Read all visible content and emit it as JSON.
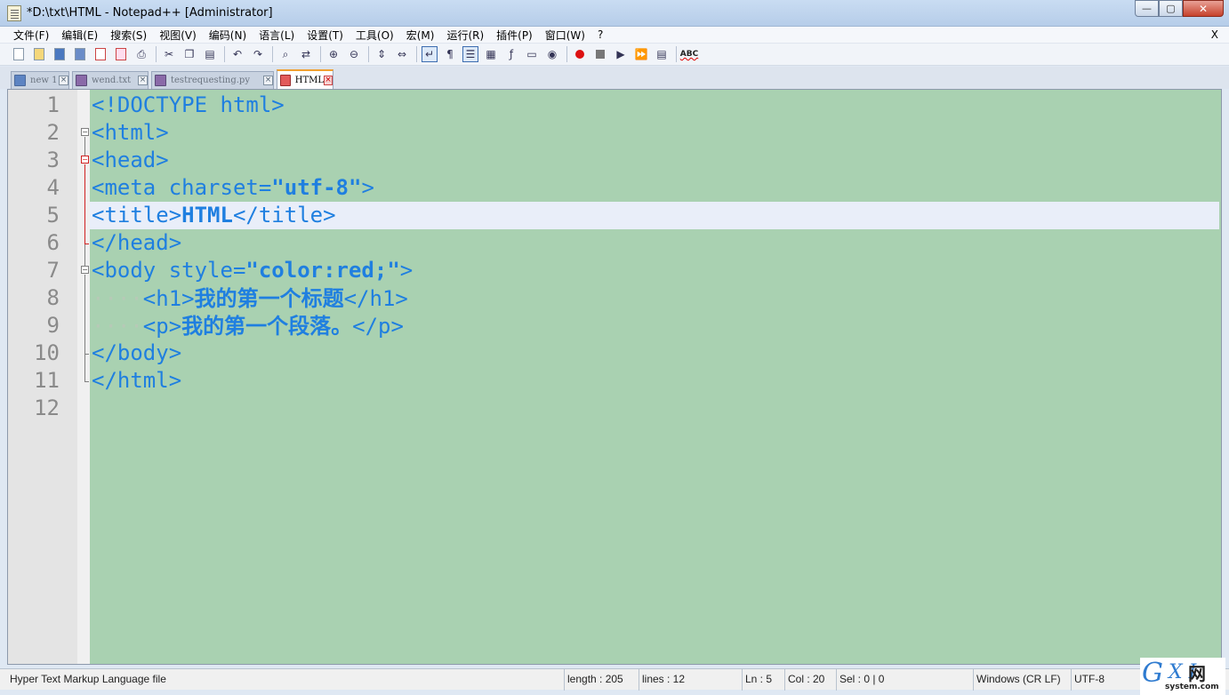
{
  "window": {
    "title": "*D:\\txt\\HTML - Notepad++ [Administrator]",
    "minimize": "—",
    "maximize": "▢",
    "close": "✕"
  },
  "menu": {
    "items": [
      "文件(F)",
      "编辑(E)",
      "搜索(S)",
      "视图(V)",
      "编码(N)",
      "语言(L)",
      "设置(T)",
      "工具(O)",
      "宏(M)",
      "运行(R)",
      "插件(P)",
      "窗口(W)",
      "?"
    ],
    "close_label": "X"
  },
  "toolbar": {
    "icons": [
      "new-file-icon",
      "open-file-icon",
      "save-icon",
      "save-all-icon",
      "close-file-icon",
      "close-all-icon",
      "print-icon",
      "cut-icon",
      "copy-icon",
      "paste-icon",
      "undo-icon",
      "redo-icon",
      "find-icon",
      "replace-icon",
      "zoom-in-icon",
      "zoom-out-icon",
      "sync-vertical-icon",
      "sync-horizontal-icon",
      "word-wrap-icon",
      "show-all-chars-icon",
      "indent-guide-icon",
      "doc-map-icon",
      "function-list-icon",
      "folder-workspace-icon",
      "monitoring-icon",
      "record-macro-icon",
      "stop-macro-icon",
      "play-macro-icon",
      "run-macro-multiple-icon",
      "save-macro-icon",
      "spell-check-icon"
    ],
    "spell_label": "ABC"
  },
  "tabs": [
    {
      "label": "new 1",
      "active": false
    },
    {
      "label": "wend.txt",
      "active": false
    },
    {
      "label": "testrequesting.py",
      "active": false
    },
    {
      "label": "HTML",
      "active": true
    }
  ],
  "editor": {
    "line_numbers": [
      "1",
      "2",
      "3",
      "4",
      "5",
      "6",
      "7",
      "8",
      "9",
      "10",
      "11",
      "12"
    ],
    "current_line": 5,
    "lines": [
      {
        "indent": "",
        "parts": [
          {
            "t": "<!DOCTYPE html>",
            "b": false
          }
        ]
      },
      {
        "indent": "",
        "parts": [
          {
            "t": "<html>",
            "b": false
          }
        ]
      },
      {
        "indent": "",
        "parts": [
          {
            "t": "<head>",
            "b": false
          }
        ]
      },
      {
        "indent": "",
        "parts": [
          {
            "t": "<meta charset=",
            "b": false
          },
          {
            "t": "\"utf-8\"",
            "b": true
          },
          {
            "t": ">",
            "b": false
          }
        ]
      },
      {
        "indent": "",
        "parts": [
          {
            "t": "<title>",
            "b": false
          },
          {
            "t": "HTML",
            "b": true
          },
          {
            "t": "</title>",
            "b": false
          }
        ]
      },
      {
        "indent": "",
        "parts": [
          {
            "t": "</head>",
            "b": false
          }
        ]
      },
      {
        "indent": "",
        "parts": [
          {
            "t": "<body style=",
            "b": false
          },
          {
            "t": "\"color:red;\"",
            "b": true
          },
          {
            "t": ">",
            "b": false
          }
        ]
      },
      {
        "indent": "····",
        "parts": [
          {
            "t": "<h1>",
            "b": false
          },
          {
            "t": "我的第一个标题",
            "b": true,
            "cjk": true
          },
          {
            "t": "</h1>",
            "b": false
          }
        ]
      },
      {
        "indent": "····",
        "parts": [
          {
            "t": "<p>",
            "b": false
          },
          {
            "t": "我的第一个段落。",
            "b": true,
            "cjk": true
          },
          {
            "t": "</p>",
            "b": false
          }
        ]
      },
      {
        "indent": "",
        "parts": [
          {
            "t": "</body>",
            "b": false
          }
        ]
      },
      {
        "indent": "",
        "parts": [
          {
            "t": "</html>",
            "b": false
          }
        ]
      },
      {
        "indent": "",
        "parts": []
      }
    ],
    "colors": {
      "background": "#a9d1b1",
      "text": "#1f7fe0",
      "current_line": "#e9eef9",
      "gutter": "#e4e4e4"
    }
  },
  "status": {
    "file_type": "Hyper Text Markup Language file",
    "length": "length : 205",
    "lines": "lines : 12",
    "ln": "Ln : 5",
    "col": "Col : 20",
    "sel": "Sel : 0 | 0",
    "eol": "Windows (CR LF)",
    "encoding": "UTF-8"
  },
  "watermark": {
    "g": "G",
    "xi": "X I",
    "cn": "网",
    "url": "system.com"
  }
}
